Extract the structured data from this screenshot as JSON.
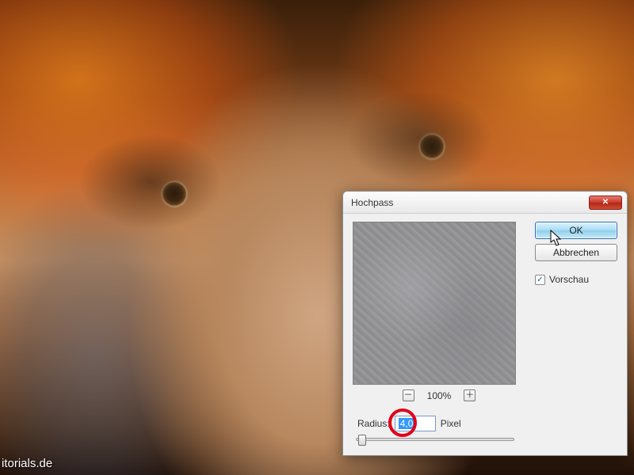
{
  "watermark": "itorials.de",
  "dialog": {
    "title": "Hochpass",
    "ok_label": "OK",
    "cancel_label": "Abbrechen",
    "preview_checkbox_label": "Vorschau",
    "preview_checked": true,
    "zoom": {
      "minus": "⊟",
      "value": "100%",
      "plus": "⊞"
    },
    "radius": {
      "label": "Radius:",
      "value": "4,0",
      "unit": "Pixel"
    }
  }
}
